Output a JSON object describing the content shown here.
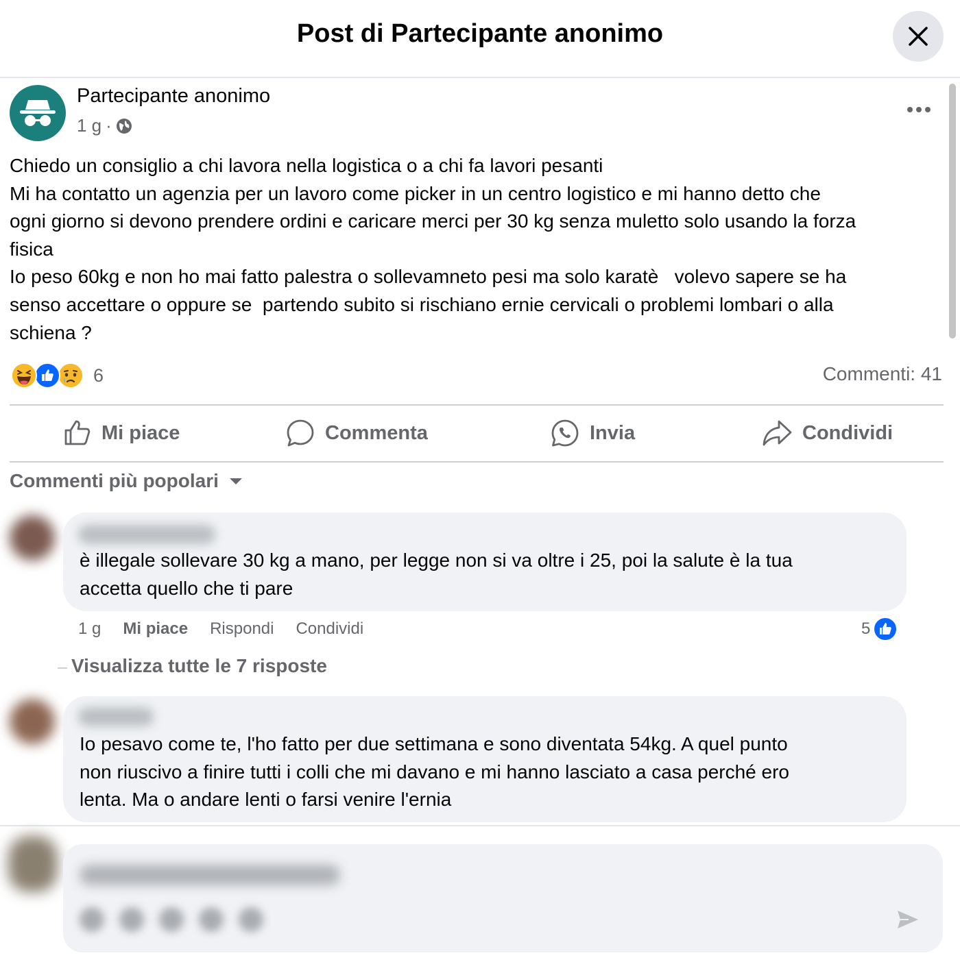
{
  "header": {
    "title": "Post di Partecipante anonimo"
  },
  "post": {
    "author": "Partecipante anonimo",
    "time": "1 g",
    "separator": "·",
    "text_lines": [
      "Chiedo un consiglio a chi lavora nella logistica o a chi fa lavori pesanti",
      "Mi ha contatto un agenzia per un lavoro come picker in un centro logistico e mi hanno detto che",
      "ogni giorno si devono prendere ordini e caricare merci per 30 kg senza muletto solo usando la forza",
      "fisica",
      "Io peso 60kg e non ho mai fatto palestra o sollevamneto pesi ma solo karatè   volevo sapere se ha",
      "senso accettare o oppure se  partendo subito si rischiano ernie cervicali o problemi lombari o alla",
      "schiena ?"
    ],
    "reaction_count": "6",
    "comments_count": "Commenti: 41"
  },
  "actions": {
    "like": "Mi piace",
    "comment": "Commenta",
    "send": "Invia",
    "share": "Condividi"
  },
  "sort_label": "Commenti più popolari",
  "comments": [
    {
      "text_lines": [
        "è illegale sollevare 30 kg a mano, per legge non si va oltre i 25, poi la salute è la tua",
        "accetta quello che ti pare"
      ],
      "time": "1 g",
      "like": "Mi piace",
      "reply": "Rispondi",
      "share": "Condividi",
      "likes": "5",
      "view_replies": "Visualizza tutte le 7 risposte"
    },
    {
      "text_lines": [
        "Io pesavo come te, l'ho fatto per due settimana e sono diventata 54kg. A quel punto",
        "non riuscivo a finire tutti i colli che mi davano e mi hanno lasciato a casa perché ero",
        "lenta. Ma o andare lenti o farsi venire l'ernia"
      ]
    }
  ],
  "colors": {
    "accent_blue": "#0866ff",
    "avatar_teal": "#1b7f7c",
    "secondary_text": "#65676b",
    "bubble_bg": "#f0f2f5"
  },
  "icons": [
    "close-icon",
    "incognito-icon",
    "globe-icon",
    "more-icon",
    "haha-reaction-icon",
    "like-reaction-icon",
    "sad-reaction-icon",
    "thumbs-up-icon",
    "comment-icon",
    "whatsapp-icon",
    "share-icon",
    "caret-down-icon",
    "send-icon"
  ]
}
